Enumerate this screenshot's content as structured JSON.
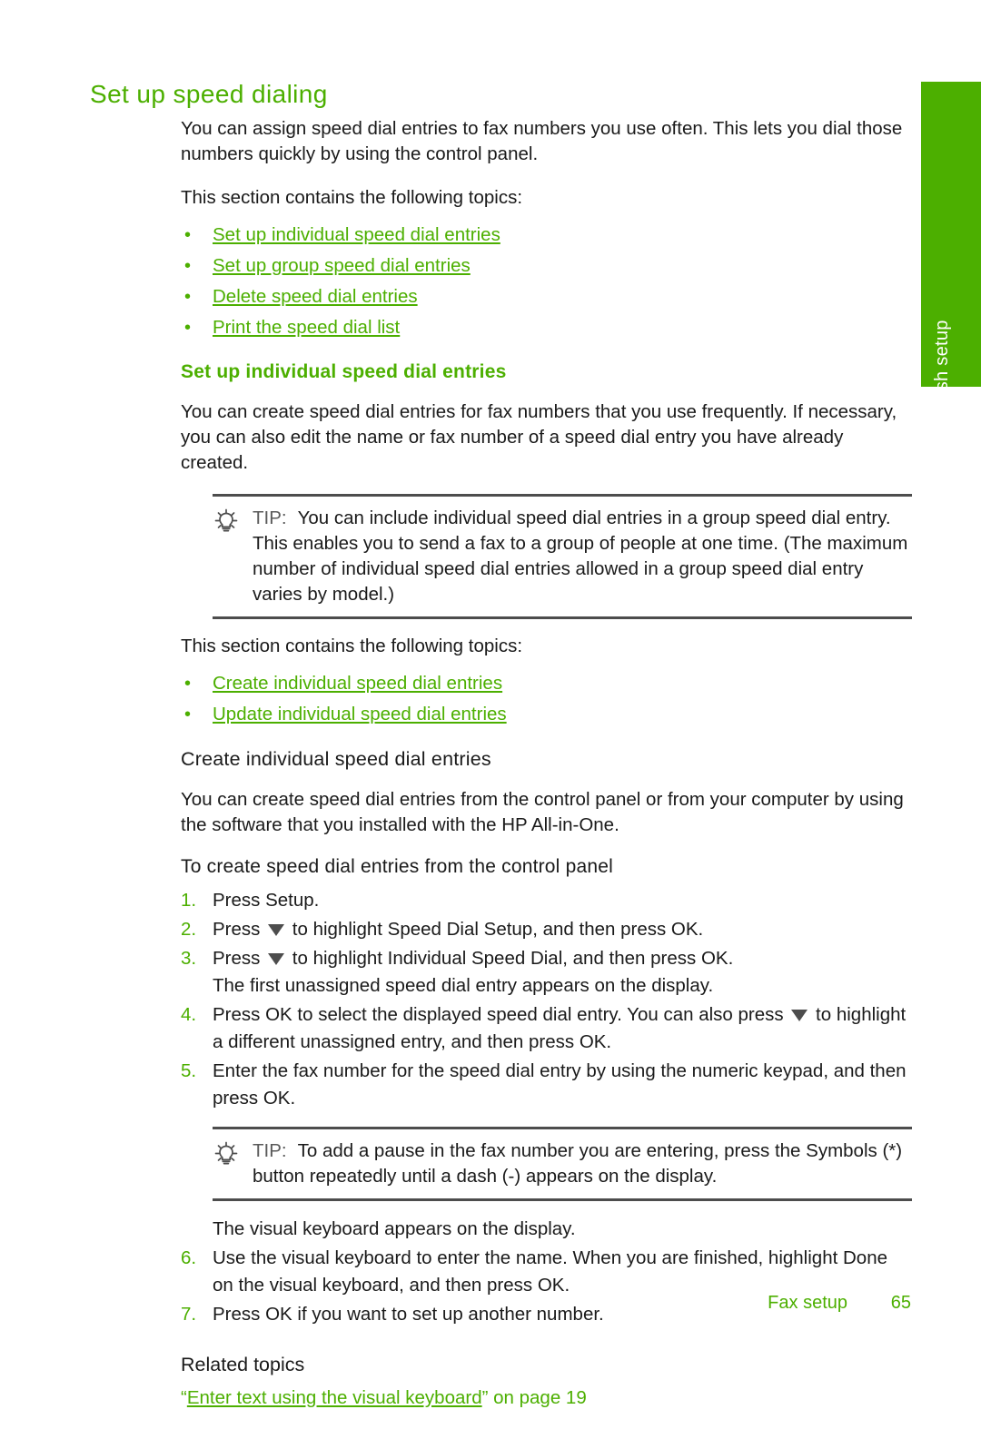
{
  "side_tab": {
    "label": "Finish setup",
    "color": "#4caf00"
  },
  "page": {
    "title": "Set up speed dialing",
    "title_color": "#4caf00"
  },
  "intro": {
    "paragraph": "You can assign speed dial entries to fax numbers you use often. This lets you dial those numbers quickly by using the control panel.",
    "topics_lead": "This section contains the following topics:"
  },
  "topic_links": [
    {
      "bullet": "•",
      "text": "Set up individual speed dial entries"
    },
    {
      "bullet": "•",
      "text": "Set up group speed dial entries"
    },
    {
      "bullet": "•",
      "text": "Delete speed dial entries"
    },
    {
      "bullet": "•",
      "text": "Print the speed dial list"
    }
  ],
  "section_individual": {
    "heading": "Set up individual speed dial entries",
    "paragraph": "You can create speed dial entries for fax numbers that you use frequently. If necessary, you can also edit the name or fax number of a speed dial entry you have already created.",
    "tip": {
      "icon": "lightbulb-icon",
      "label": "TIP:",
      "text": "You can include individual speed dial entries in a group speed dial entry. This enables you to send a fax to a group of people at one time. (The maximum number of individual speed dial entries allowed in a group speed dial entry varies by model.)"
    },
    "topics_lead": "This section contains the following topics:",
    "links": [
      {
        "bullet": "•",
        "text": "Create individual speed dial entries"
      },
      {
        "bullet": "•",
        "text": "Update individual speed dial entries"
      }
    ]
  },
  "section_create": {
    "heading": "Create individual speed dial entries",
    "paragraph": "You can create speed dial entries from the control panel or from your computer by using the software that you installed with the HP All-in-One.",
    "procedure_heading": "To create speed dial entries from the control panel",
    "steps": [
      {
        "num": "1.",
        "text": "Press Setup."
      },
      {
        "num": "2.",
        "pre": "Press ",
        "icon": "down-arrow-icon",
        "post": " to highlight Speed Dial Setup, and then press OK."
      },
      {
        "num": "3.",
        "pre": "Press ",
        "icon": "down-arrow-icon",
        "post": " to highlight Individual Speed Dial, and then press OK.",
        "sub": "The first unassigned speed dial entry appears on the display."
      },
      {
        "num": "4.",
        "pre": "Press OK to select the displayed speed dial entry. You can also press ",
        "icon": "down-arrow-icon",
        "post": " to highlight a different unassigned entry, and then press OK."
      },
      {
        "num": "5.",
        "text": "Enter the fax number for the speed dial entry by using the numeric keypad, and then press OK."
      }
    ],
    "tip": {
      "icon": "lightbulb-icon",
      "label": "TIP:",
      "text": "To add a pause in the fax number you are entering, press the Symbols (*) button repeatedly until a dash (-) appears on the display."
    },
    "post_tip_note": "The visual keyboard appears on the display.",
    "steps_after": [
      {
        "num": "6.",
        "text": "Use the visual keyboard to enter the name. When you are finished, highlight Done on the visual keyboard, and then press OK."
      },
      {
        "num": "7.",
        "text": "Press OK if you want to set up another number."
      }
    ]
  },
  "related": {
    "heading": "Related topics",
    "open_quote": "“",
    "link_text": "Enter text using the visual keyboard",
    "close_quote": "”",
    "suffix": " on page 19"
  },
  "footer": {
    "label": "Fax setup",
    "page_number": "65",
    "color": "#4caf00"
  }
}
